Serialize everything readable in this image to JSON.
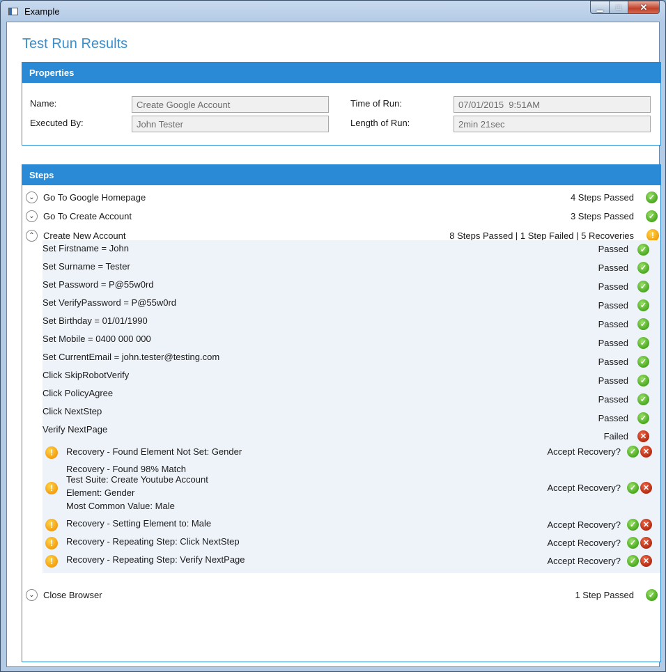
{
  "window": {
    "title": "Example"
  },
  "page": {
    "title": "Test Run Results"
  },
  "properties": {
    "header": "Properties",
    "name_label": "Name:",
    "name_value": "Create Google Account",
    "executed_by_label": "Executed By:",
    "executed_by_value": "John Tester",
    "time_label": "Time of Run:",
    "time_value": "07/01/2015  9:51AM",
    "length_label": "Length of Run:",
    "length_value": "2min 21sec"
  },
  "steps": {
    "header": "Steps",
    "groups": [
      {
        "label": "Go To Google Homepage",
        "status": "4 Steps Passed"
      },
      {
        "label": "Go To Create Account",
        "status": "3 Steps Passed"
      },
      {
        "label": "Create New Account",
        "status": "8 Steps Passed  |  1 Step Failed  |  5 Recoveries"
      },
      {
        "label": "Close Browser",
        "status": "1 Step Passed"
      }
    ],
    "substeps": [
      {
        "label": "Set Firstname = John",
        "status": "Passed"
      },
      {
        "label": "Set Surname = Tester",
        "status": "Passed"
      },
      {
        "label": "Set Password = P@55w0rd",
        "status": "Passed"
      },
      {
        "label": "Set VerifyPassword = P@55w0rd",
        "status": "Passed"
      },
      {
        "label": "Set Birthday = 01/01/1990",
        "status": "Passed"
      },
      {
        "label": "Set Mobile = 0400 000 000",
        "status": "Passed"
      },
      {
        "label": "Set CurrentEmail = john.tester@testing.com",
        "status": "Passed"
      },
      {
        "label": "Click SkipRobotVerify",
        "status": "Passed"
      },
      {
        "label": "Click PolicyAgree",
        "status": "Passed"
      },
      {
        "label": "Click NextStep",
        "status": "Passed"
      },
      {
        "label": "Verify NextPage",
        "status": "Failed"
      }
    ],
    "recoveries": [
      {
        "lines": [
          "Recovery - Found Element Not Set:  Gender"
        ],
        "prompt": "Accept Recovery?"
      },
      {
        "lines": [
          "Recovery - Found 98% Match",
          "Test Suite:  Create Youtube Account",
          "Element:  Gender",
          "Most Common Value:  Male"
        ],
        "prompt": "Accept Recovery?"
      },
      {
        "lines": [
          "Recovery - Setting Element to:  Male"
        ],
        "prompt": "Accept Recovery?"
      },
      {
        "lines": [
          "Recovery - Repeating Step:  Click NextStep"
        ],
        "prompt": "Accept Recovery?"
      },
      {
        "lines": [
          "Recovery - Repeating Step:  Verify NextPage"
        ],
        "prompt": "Accept Recovery?"
      }
    ]
  },
  "icons": {
    "expand": "chevron-down-icon",
    "collapse": "chevron-up-icon",
    "passed": "check-icon",
    "failed": "x-icon",
    "warning": "exclamation-icon"
  },
  "colors": {
    "accent": "#2a8ad6",
    "title": "#3c8ec9",
    "passed": "#4aa81f",
    "failed": "#b32a10",
    "warning": "#f29a0a"
  }
}
